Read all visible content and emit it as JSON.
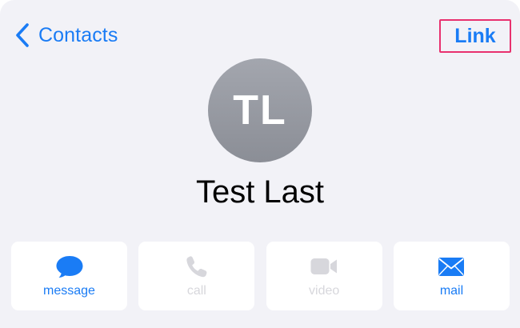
{
  "nav": {
    "back_label": "Contacts",
    "link_label": "Link"
  },
  "contact": {
    "initials": "TL",
    "name": "Test Last"
  },
  "actions": [
    {
      "label": "message",
      "icon": "message-bubble-icon",
      "enabled": true
    },
    {
      "label": "call",
      "icon": "phone-icon",
      "enabled": false
    },
    {
      "label": "video",
      "icon": "video-camera-icon",
      "enabled": false
    },
    {
      "label": "mail",
      "icon": "envelope-icon",
      "enabled": true
    }
  ],
  "colors": {
    "accent": "#1a7cf5",
    "highlight_border": "#e8316e",
    "disabled": "#d7d7dc",
    "avatar": "#9a9da5",
    "background": "#f2f2f7"
  }
}
